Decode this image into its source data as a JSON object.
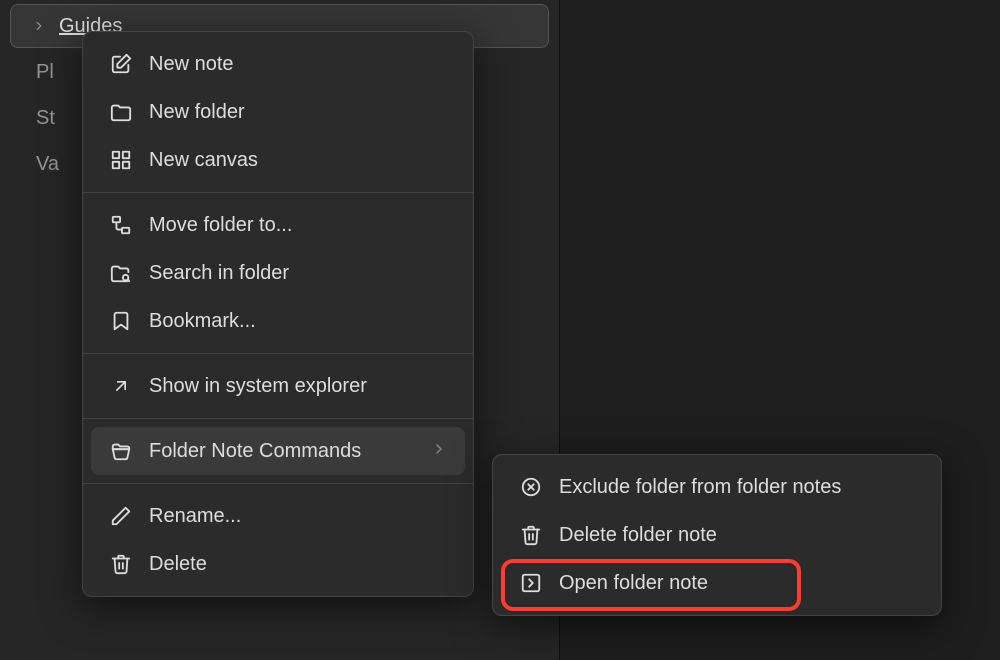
{
  "sidebar": {
    "items": [
      {
        "label": "Guides"
      },
      {
        "label": "Pl"
      },
      {
        "label": "St"
      },
      {
        "label": "Va"
      }
    ]
  },
  "context_menu": {
    "groups": [
      [
        {
          "label": "New note"
        },
        {
          "label": "New folder"
        },
        {
          "label": "New canvas"
        }
      ],
      [
        {
          "label": "Move folder to..."
        },
        {
          "label": "Search in folder"
        },
        {
          "label": "Bookmark..."
        }
      ],
      [
        {
          "label": "Show in system explorer"
        }
      ],
      [
        {
          "label": "Folder Note Commands"
        }
      ],
      [
        {
          "label": "Rename..."
        },
        {
          "label": "Delete"
        }
      ]
    ]
  },
  "submenu": {
    "items": [
      {
        "label": "Exclude folder from folder notes"
      },
      {
        "label": "Delete folder note"
      },
      {
        "label": "Open folder note"
      }
    ]
  }
}
